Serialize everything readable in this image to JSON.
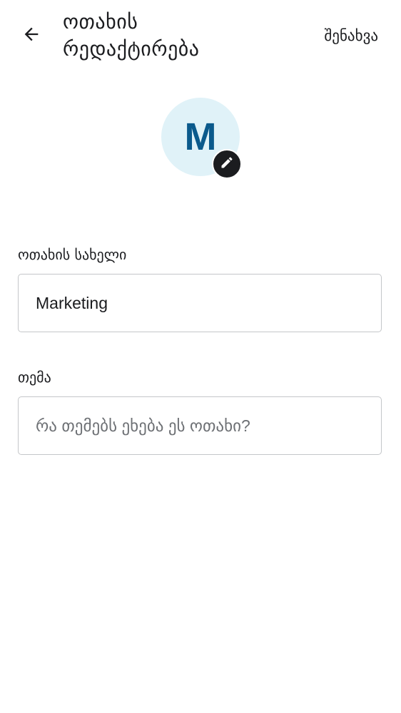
{
  "header": {
    "title": "ოთახის რედაქტირება",
    "save_label": "შენახვა",
    "back_icon": "arrow-left-icon"
  },
  "avatar": {
    "initial": "M",
    "background_color": "#e0f2f8",
    "text_color": "#0b5a8c",
    "edit_icon": "pencil-icon"
  },
  "form": {
    "room_name": {
      "label": "ოთახის სახელი",
      "value": "Marketing"
    },
    "topic": {
      "label": "თემა",
      "value": "",
      "placeholder": "რა თემებს ეხება ეს ოთახი?"
    }
  }
}
